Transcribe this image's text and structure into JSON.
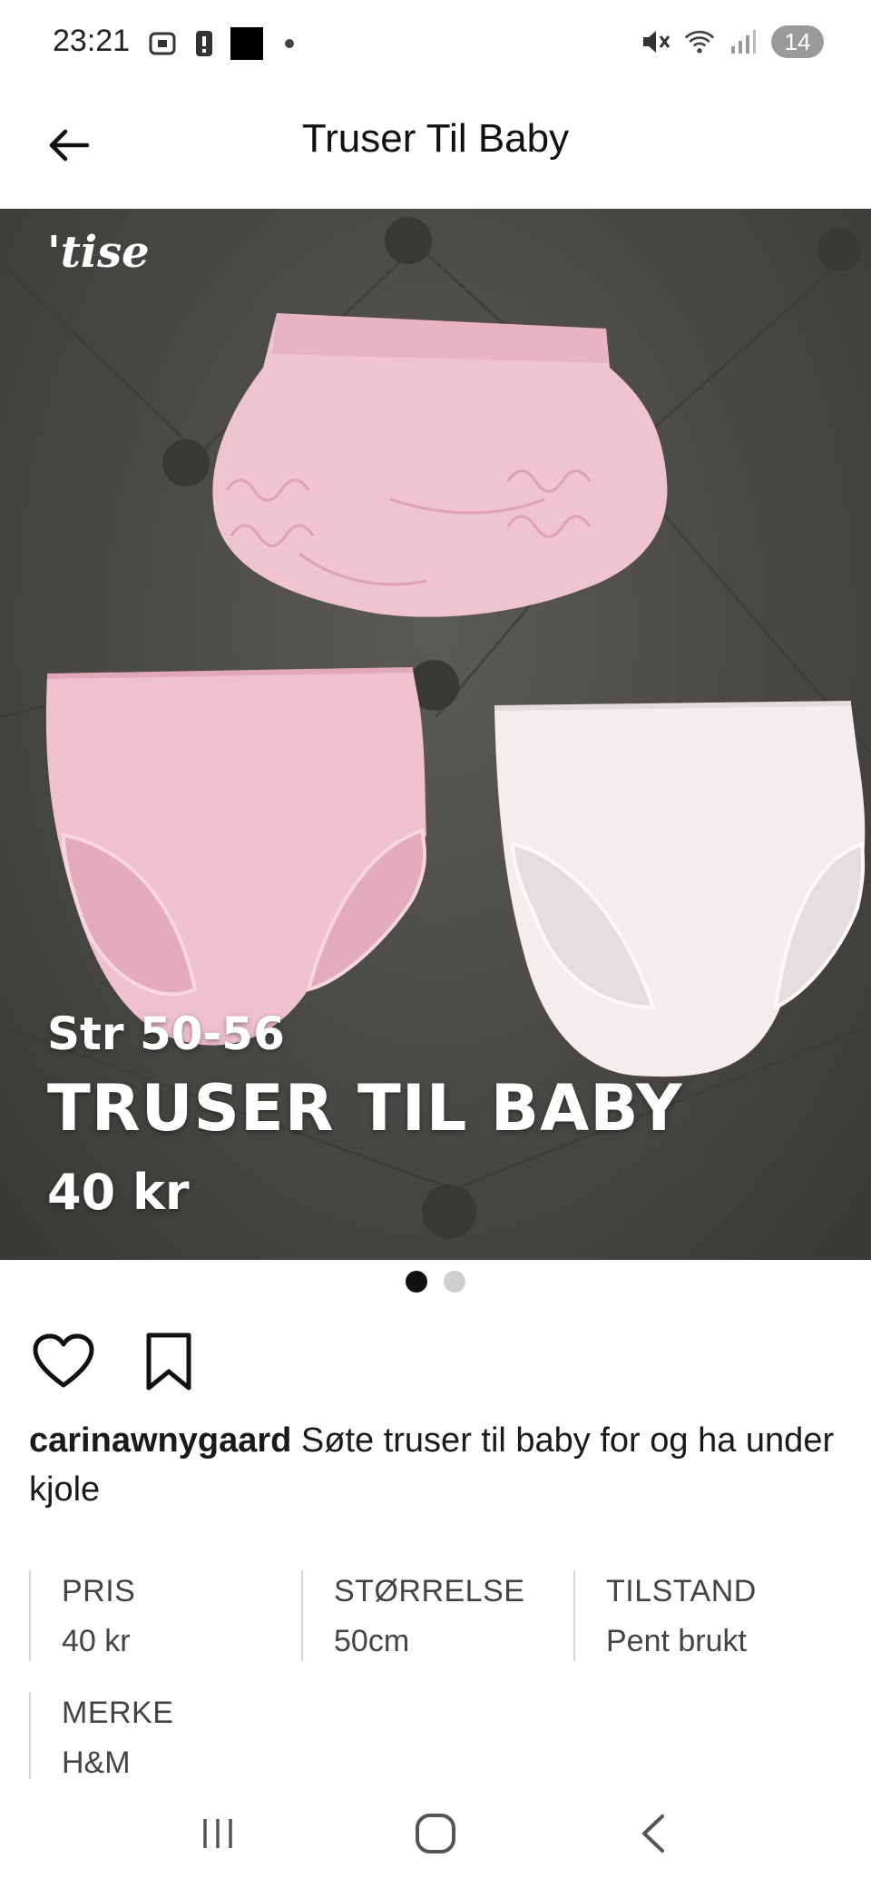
{
  "status_bar": {
    "time": "23:21",
    "notification_count": "14"
  },
  "header": {
    "title": "Truser Til Baby",
    "back_icon": "arrow-left-icon"
  },
  "photo": {
    "watermark": "'tise",
    "overlay_size": "Str 50-56",
    "overlay_title": "TRUSER TIL BABY",
    "overlay_price": "40 kr",
    "page_count": 2,
    "active_page": 1
  },
  "actions": {
    "like_icon": "heart-icon",
    "save_icon": "bookmark-icon"
  },
  "description": {
    "username": "carinawnygaard",
    "text": "Søte truser til baby for og ha under kjole"
  },
  "attributes": [
    {
      "label": "PRIS",
      "value": "40 kr"
    },
    {
      "label": "STØRRELSE",
      "value": "50cm"
    },
    {
      "label": "TILSTAND",
      "value": "Pent brukt"
    },
    {
      "label": "MERKE",
      "value": "H&M"
    }
  ],
  "nav": {
    "recents_icon": "recents-icon",
    "home_icon": "home-icon",
    "back_icon": "back-chevron-icon"
  },
  "colors": {
    "pink": "#f2c4d2",
    "white_item": "#f3eeee",
    "background_fabric": "#4a4844"
  }
}
